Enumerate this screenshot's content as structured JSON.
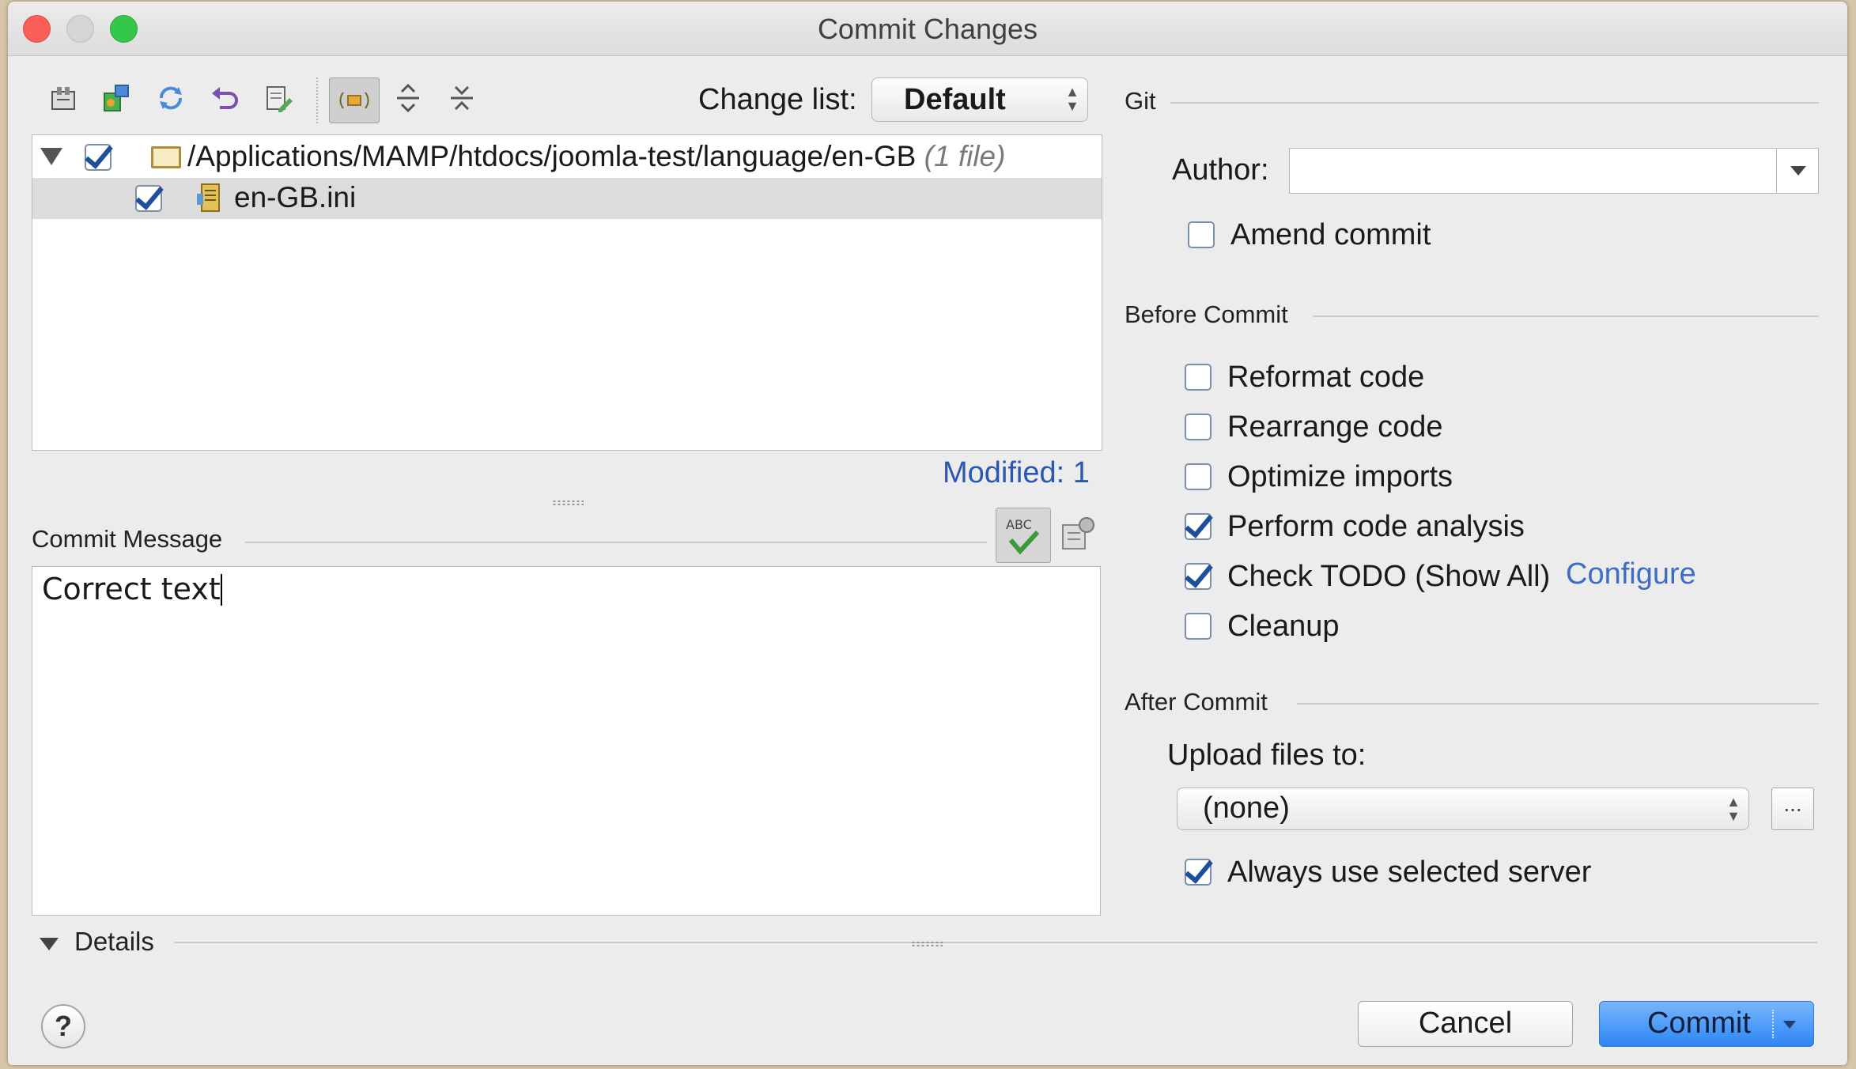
{
  "window": {
    "title": "Commit Changes"
  },
  "toolbar": {
    "icons": [
      "show-diff-icon",
      "move-to-changelist-icon",
      "refresh-icon",
      "rollback-icon",
      "edit-source-icon",
      "group-by-directory-icon",
      "expand-all-icon",
      "collapse-all-icon"
    ],
    "changelist_label": "Change list:",
    "changelist_value": "Default"
  },
  "tree": {
    "folder_path": "/Applications/MAMP/htdocs/joomla-test/language/en-GB",
    "folder_count": "(1 file)",
    "file_name": "en-GB.ini",
    "folder_checked": true,
    "file_checked": true
  },
  "modified_label": "Modified: 1",
  "commit_message": {
    "title": "Commit Message",
    "text": "Correct text"
  },
  "details_label": "Details",
  "help_label": "?",
  "git": {
    "title": "Git",
    "author_label": "Author:",
    "author_value": "",
    "amend_label": "Amend commit",
    "amend_checked": false
  },
  "before_commit": {
    "title": "Before Commit",
    "options": [
      {
        "label": "Reformat code",
        "checked": false
      },
      {
        "label": "Rearrange code",
        "checked": false
      },
      {
        "label": "Optimize imports",
        "checked": false
      },
      {
        "label": "Perform code analysis",
        "checked": true
      },
      {
        "label": "Check TODO (Show All)",
        "checked": true
      },
      {
        "label": "Cleanup",
        "checked": false
      }
    ],
    "configure_link": "Configure"
  },
  "after_commit": {
    "title": "After Commit",
    "upload_label": "Upload files to:",
    "upload_value": "(none)",
    "browse_label": "...",
    "always_label": "Always use selected server",
    "always_checked": true
  },
  "buttons": {
    "cancel": "Cancel",
    "commit": "Commit"
  },
  "colors": {
    "accent": "#2d86f6",
    "link": "#3d6ec2",
    "modified": "#2a58b0"
  }
}
